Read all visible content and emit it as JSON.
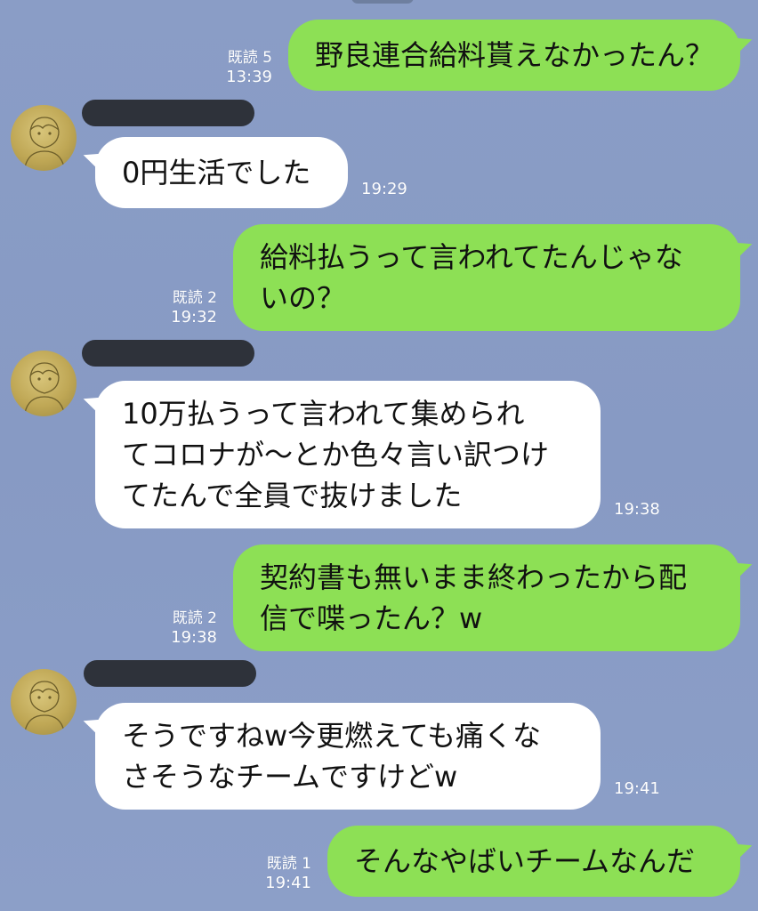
{
  "messages": [
    {
      "side": "out",
      "read": "既読 5",
      "time": "13:39",
      "text": "野良連合給料貰えなかったん？"
    },
    {
      "side": "in",
      "time": "19:29",
      "text": "0円生活でした"
    },
    {
      "side": "out",
      "read": "既読 2",
      "time": "19:32",
      "text": "給料払うって言われてたんじゃな\nいの？"
    },
    {
      "side": "in",
      "time": "19:38",
      "text": "10万払うって言われて集められ\nてコロナが〜とか色々言い訳つけ\nてたんで全員で抜けました"
    },
    {
      "side": "out",
      "read": "既読 2",
      "time": "19:38",
      "text": "契約書も無いまま終わったから配\n信で喋ったん？w"
    },
    {
      "side": "in",
      "time": "19:41",
      "text": "そうですねw今更燃えても痛くな\nさそうなチームですけどw"
    },
    {
      "side": "out",
      "read": "既読 1",
      "time": "19:41",
      "text": "そんなやばいチームなんだ"
    }
  ],
  "colors": {
    "background": "#8a9dc6",
    "outgoing_bubble": "#8de055",
    "incoming_bubble": "#ffffff",
    "redaction": "#2e323a"
  }
}
